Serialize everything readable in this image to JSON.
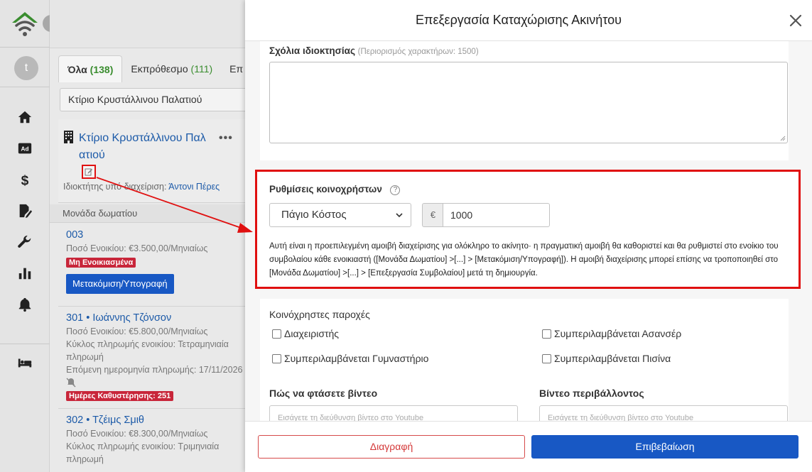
{
  "colors": {
    "brand_green": "#3a8d2f",
    "link_blue": "#1c5aa8",
    "primary": "#1858c4",
    "danger": "#c8263a",
    "annotation_red": "#e01010"
  },
  "nav": {
    "avatar_letter": "t",
    "items": [
      {
        "icon": "home-icon"
      },
      {
        "icon": "ad-icon",
        "label": "Ad"
      },
      {
        "icon": "dollar-icon",
        "label": "$"
      },
      {
        "icon": "contract-icon"
      },
      {
        "icon": "wrench-icon"
      },
      {
        "icon": "bar-chart-icon"
      },
      {
        "icon": "bell-icon"
      },
      {
        "icon": "bed-icon"
      }
    ]
  },
  "list": {
    "tabs": [
      {
        "label": "Όλα",
        "count": "(138)"
      },
      {
        "label": "Εκπρόθεσμο",
        "count": "(111)"
      },
      {
        "label": "Επ",
        "count": ""
      }
    ],
    "filter_value": "Κτίριο Κρυστάλλινου Παλατιού",
    "building": {
      "name_line1": "Κτίριο Κρυστάλλινου Παλ",
      "name_line2": "ατιού",
      "owner_label": "Ιδιοκτήτης υπό διαχείριση:",
      "owner_name": "Άντονι Πέρες"
    },
    "section_title": "Μονάδα δωματίου",
    "units": [
      {
        "name": "003",
        "lines": [
          "Ποσό Ενοικίου: €3.500,00/Μηνιαίως"
        ],
        "badge": "Μη Ενοικιασμένα",
        "button": "Μετακόμιση/Υπογραφή"
      },
      {
        "name": "301 • Ιωάννης Τζόνσον",
        "lines": [
          "Ποσό Ενοικίου: €5.800,00/Μηνιαίως",
          "Κύκλος πληρωμής ενοικίου: Τετραμηνιαία",
          "πληρωμή",
          "Επόμενη ημερομηνία πληρωμής:  17/11/2026"
        ],
        "badge": "Ημέρες Καθυστέρησης: 251"
      },
      {
        "name": "302 • Τζέιμς Σμιθ",
        "lines": [
          "Ποσό Ενοικίου: €8.300,00/Μηνιαίως",
          "Κύκλος πληρωμής ενοικίου: Τριμηνιαία",
          "πληρωμή"
        ]
      }
    ]
  },
  "modal": {
    "title": "Επεξεργασία Καταχώρισης Ακινήτου",
    "comments_label": "Σχόλια ιδιοκτησίας",
    "comments_hint": "(Περιορισμός χαρακτήρων: 1500)",
    "comments_value": "",
    "fees": {
      "label": "Ρυθμίσεις κοινοχρήστων",
      "help": "?",
      "type_selected": "Πάγιο Κόστος",
      "currency": "€",
      "amount": "1000",
      "description": "Αυτή είναι η προεπιλεγμένη αμοιβή διαχείρισης για ολόκληρο το ακίνητο· η πραγματική αμοιβή θα καθοριστεί και θα ρυθμιστεί στο ενοίκιο του συμβολαίου κάθε ενοικιαστή ([Μονάδα Δωματίου] >[...] > [Μετακόμιση/Υπογραφή]). Η αμοιβή διαχείρισης μπορεί επίσης να τροποποιηθεί στο [Μονάδα Δωματίου] >[...] > [Επεξεργασία Συμβολαίου] μετά τη δημιουργία."
    },
    "amenities": {
      "label": "Κοινόχρηστες παροχές",
      "items": [
        {
          "label": "Διαχειριστής",
          "checked": false
        },
        {
          "label": "Συμπεριλαμβάνεται Ασανσέρ",
          "checked": false
        },
        {
          "label": "Συμπεριλαμβάνεται Γυμναστήριο",
          "checked": false
        },
        {
          "label": "Συμπεριλαμβάνεται Πισίνα",
          "checked": false
        }
      ]
    },
    "video_directions": {
      "label": "Πώς να φτάσετε βίντεο",
      "placeholder": "Εισάγετε τη διεύθυνση βίντεο στο Youtube"
    },
    "video_surroundings": {
      "label": "Βίντεο περιβάλλοντος",
      "placeholder": "Εισάγετε τη διεύθυνση βίντεο στο Youtube"
    },
    "delete_label": "Διαγραφή",
    "confirm_label": "Επιβεβαίωση"
  }
}
